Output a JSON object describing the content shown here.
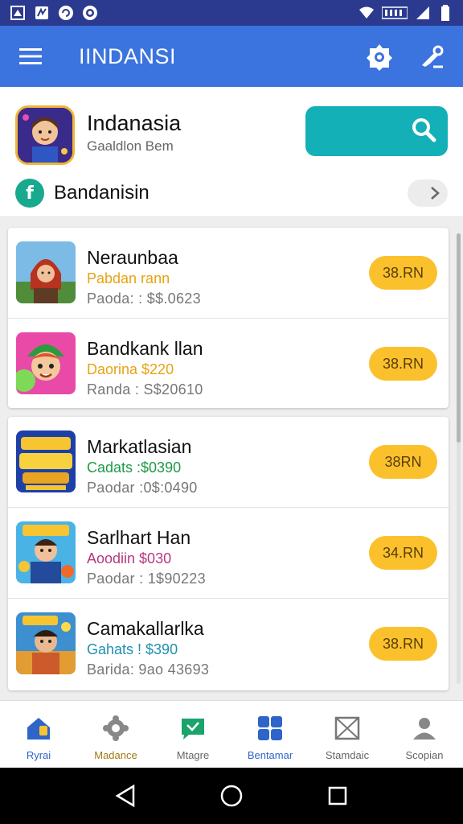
{
  "app_bar": {
    "title": "IINDANSI"
  },
  "header": {
    "title": "Indanasia",
    "subtitle": "Gaaldlon Bem",
    "facebook_label": "Bandanisin"
  },
  "apps_group_1": [
    {
      "name": "Neraunbaa",
      "sub": "Pabdan rann",
      "sub_color": "#e7a312",
      "meta": "Paoda: : $$.0623",
      "price": "38.RN"
    },
    {
      "name": "Bandkank llan",
      "sub": "Daorina $220",
      "sub_color": "#e7a312",
      "meta": "Randa : S$20610",
      "price": "38.RN"
    }
  ],
  "apps_group_2": [
    {
      "name": "Markatlasian",
      "sub": "Cadats :$0390",
      "sub_color": "#1e9a48",
      "meta": "Paodar :0$:0490",
      "price": "38RN"
    },
    {
      "name": "Sarlhart Han",
      "sub": "Aoodiin $030",
      "sub_color": "#b5397f",
      "meta": "Paodar : 1$90223",
      "price": "34.RN"
    },
    {
      "name": "Camakallarlka",
      "sub": "Gahats ! $390",
      "sub_color": "#1f8fb0",
      "meta": "Barida: 9ao 43693",
      "price": "38.RN"
    }
  ],
  "bottom_nav": [
    {
      "label": "Ryrai",
      "icon": "home-icon",
      "state": "active-blue"
    },
    {
      "label": "Madance",
      "icon": "gear-icon",
      "state": "active-gold"
    },
    {
      "label": "Mtagre",
      "icon": "chat-icon",
      "state": ""
    },
    {
      "label": "Bentamar",
      "icon": "grid-icon",
      "state": "active-blue"
    },
    {
      "label": "Stamdaic",
      "icon": "mail-icon",
      "state": ""
    },
    {
      "label": "Scopian",
      "icon": "person-icon",
      "state": ""
    }
  ],
  "colors": {
    "app_bar": "#3b73df",
    "status_bar": "#2b3a8f",
    "price_button": "#fbc12d",
    "search_button": "#14b0b8"
  }
}
